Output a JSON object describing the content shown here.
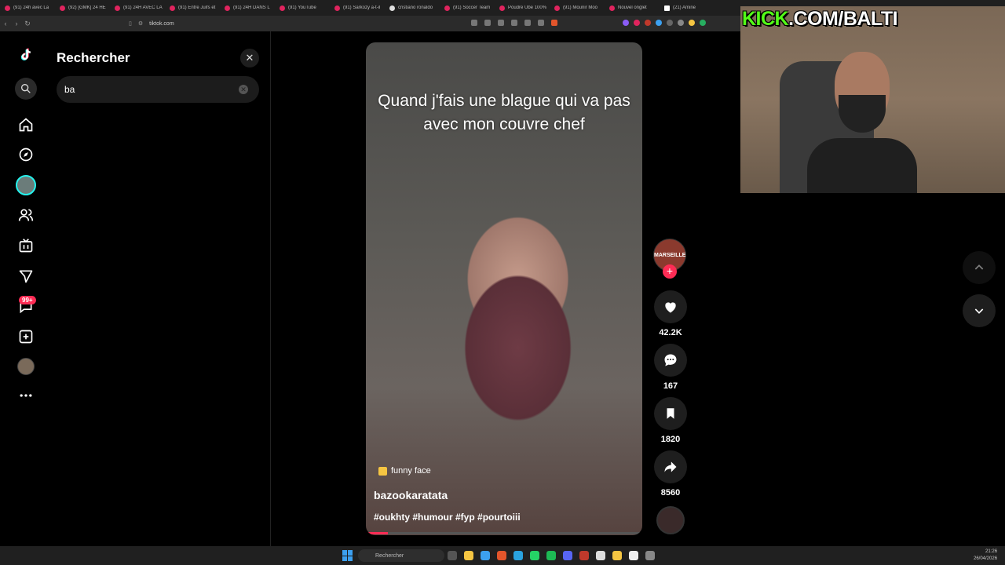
{
  "browser": {
    "tabs": [
      {
        "label": "(91) 24h avec La",
        "icon": "youtube-icon"
      },
      {
        "label": "(92) [GMK] 24 HE",
        "icon": "youtube-icon"
      },
      {
        "label": "(91) 24H AVEC LA",
        "icon": "youtube-icon"
      },
      {
        "label": "(91) Entre Juifs et",
        "icon": "youtube-icon"
      },
      {
        "label": "(91) 24H DANS L",
        "icon": "youtube-icon"
      },
      {
        "label": "(91) YouTube",
        "icon": "youtube-icon"
      },
      {
        "label": "(91) Sarkozy a-t-il",
        "icon": "youtube-icon"
      },
      {
        "label": "cristiano ronaldo",
        "icon": "google-icon"
      },
      {
        "label": "(91) Soccer Team",
        "icon": "youtube-icon"
      },
      {
        "label": "Poudre Ube 100%",
        "icon": "shop-icon"
      },
      {
        "label": "(91) Mounir Moo",
        "icon": "youtube-icon"
      },
      {
        "label": "Nouvel onglet",
        "icon": "newtab-icon"
      },
      {
        "label": "(21) Amine",
        "icon": "x-icon"
      }
    ],
    "url": "tiktok.com"
  },
  "sidebar": {
    "items": [
      {
        "name": "search",
        "icon": "search-icon"
      },
      {
        "name": "home",
        "icon": "home-icon"
      },
      {
        "name": "explore",
        "icon": "compass-icon"
      },
      {
        "name": "following",
        "icon": "following-avatar-icon"
      },
      {
        "name": "friends",
        "icon": "users-icon"
      },
      {
        "name": "live",
        "icon": "live-tv-icon"
      },
      {
        "name": "messages",
        "icon": "send-icon"
      },
      {
        "name": "inbox",
        "icon": "inbox-icon"
      },
      {
        "name": "upload",
        "icon": "plus-square-icon"
      },
      {
        "name": "profile",
        "icon": "profile-avatar-icon"
      },
      {
        "name": "more",
        "icon": "more-icon"
      }
    ],
    "inbox_badge": "99+"
  },
  "search_panel": {
    "title": "Rechercher",
    "query": "ba"
  },
  "video": {
    "caption": "Quand j'fais une blague qui va pas avec mon couvre chef",
    "effect_label": "funny face",
    "author": "bazookaratata",
    "hashtags": "#oukhty #humour #fyp #pourtoiii",
    "progress": 0.08
  },
  "actions": {
    "avatar_text": "MARSEILLE",
    "likes": "42.2K",
    "comments": "167",
    "saves": "1820",
    "shares": "8560"
  },
  "overlay": {
    "kick_brand": "KICK",
    "kick_rest": ".COM/BALTI"
  },
  "taskbar": {
    "search_placeholder": "Rechercher",
    "time": "21:26",
    "date": "26/04/2026"
  },
  "colors": {
    "accent": "#fe2c55",
    "kick_green": "#53fc18"
  }
}
